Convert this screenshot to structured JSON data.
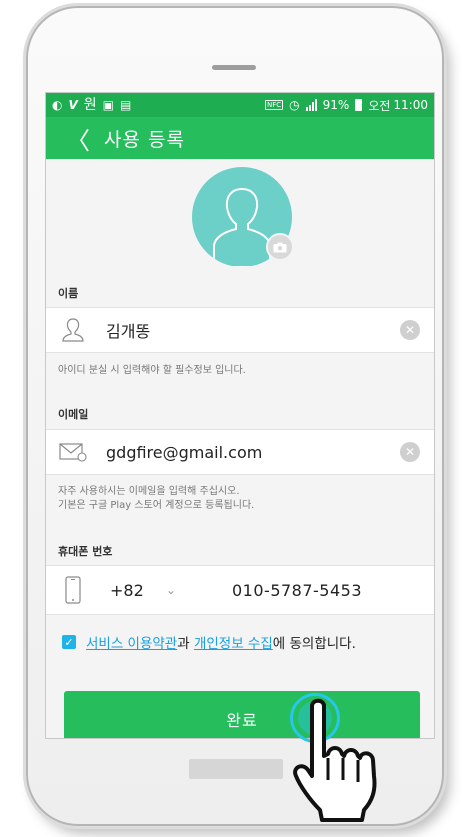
{
  "statusbar": {
    "left_icons": [
      "app-notification-icon",
      "v-icon",
      "won-icon",
      "image-icon",
      "clipboard-icon"
    ],
    "won_glyph": "원",
    "nfc_label": "NFC",
    "battery_percent": "91%",
    "ampm": "오전",
    "time": "11:00"
  },
  "appbar": {
    "back_glyph": "〈",
    "title": "사용 등록"
  },
  "form": {
    "name_section": "이름",
    "name_value": "김개똥",
    "name_hint": "아이디 분실 시 입력해야 할 필수정보 입니다.",
    "email_section": "이메일",
    "email_value": "gdgfire@gmail.com",
    "email_hint_1": "자주 사용하시는 이메일을 입력해 주십시오.",
    "email_hint_2": "기본은 구글 Play 스토어 계정으로 등록됩니다.",
    "phone_section": "휴대폰 번호",
    "country_code": "+82",
    "chevron_glyph": "⌄",
    "phone_value": "010-5787-5453",
    "clear_glyph": "✕",
    "check_glyph": "✓"
  },
  "agreement": {
    "terms_link": "서비스 이용약관",
    "conj": "과 ",
    "privacy_link": "개인정보 수집",
    "suffix": "에 동의합니다.",
    "checked": true
  },
  "done_button": "완료",
  "colors": {
    "primary": "#26bd5c",
    "status": "#1fad52",
    "avatar": "#6ccfc8",
    "link": "#1a9fe0",
    "checkbox": "#1fb3e8"
  }
}
